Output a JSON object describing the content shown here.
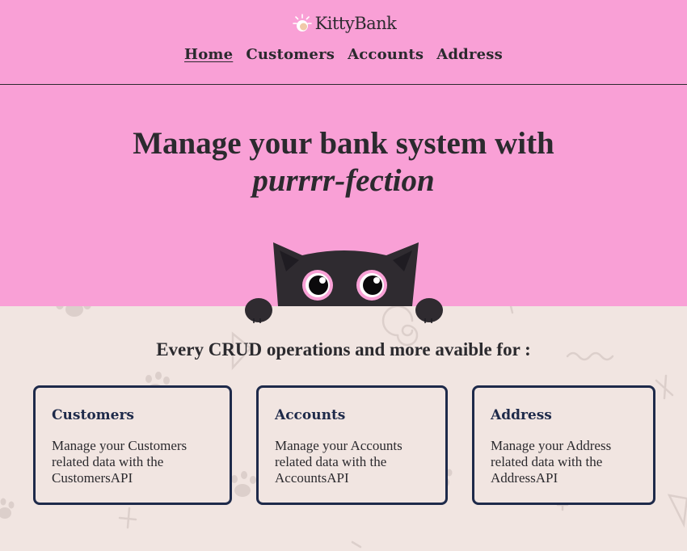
{
  "header": {
    "brand": "KittyBank",
    "nav": [
      {
        "label": "Home",
        "active": true
      },
      {
        "label": "Customers",
        "active": false
      },
      {
        "label": "Accounts",
        "active": false
      },
      {
        "label": "Address",
        "active": false
      }
    ]
  },
  "hero": {
    "title": "Manage your bank system with",
    "accent": "purrrr-fection"
  },
  "features": {
    "heading": "Every CRUD operations and more avaible for :",
    "cards": [
      {
        "title": "Customers",
        "text": "Manage your Customers related data with the CustomersAPI"
      },
      {
        "title": "Accounts",
        "text": "Manage your Accounts related data with the AccountsAPI"
      },
      {
        "title": "Address",
        "text": "Manage your Address related data with the AddressAPI"
      }
    ]
  },
  "colors": {
    "pink": "#f9a0d6",
    "cream": "#f1e5e1",
    "navy": "#1e2a4a",
    "dark": "#2b2a2e"
  },
  "icons": [
    "paw-sun-logo-icon",
    "peeking-cat-illustration",
    "paw-print-icon"
  ]
}
